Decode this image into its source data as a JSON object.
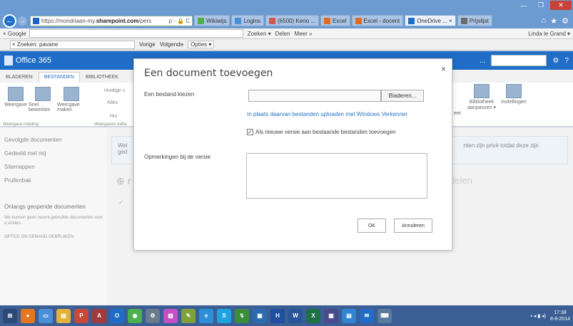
{
  "browser": {
    "address": {
      "prefix": "https://mondriaan-my.",
      "domain": "sharepoint.com",
      "suffix": "/pers",
      "icons": "ρ - 🔒 C"
    },
    "tabs": [
      {
        "label": "Wikiwijs",
        "color": "#4caf50"
      },
      {
        "label": "Logins",
        "color": "#4a90d9"
      },
      {
        "label": "(6500) Kerio ...",
        "color": "#d9534f"
      },
      {
        "label": "Excel",
        "color": "#e06b1f"
      },
      {
        "label": "Excel - docent",
        "color": "#e06b1f"
      },
      {
        "label": "OneDrive ... ×",
        "color": "#1f6dc6",
        "active": true
      },
      {
        "label": "Prijslijst",
        "color": "#6b6b6b"
      }
    ],
    "nav_right": [
      "⌂",
      "★",
      "⚙"
    ],
    "google": {
      "label": "× Google",
      "buttons": [
        "Zoeken ▾",
        "Delen",
        "Meer »"
      ],
      "user": "Linda le Grand ▾"
    },
    "find": {
      "label": "× Zoeken: pavane",
      "prev": "Vorige",
      "next": "Volgende",
      "options": "Opties ▾"
    },
    "window_controls": [
      "—",
      "❐",
      "✕"
    ]
  },
  "sharepoint": {
    "suite_title": "Office 365",
    "suite_right": "...",
    "suite_icons": [
      "⚙",
      "?"
    ],
    "ribbon_tabs": [
      "BLADEREN",
      "BESTANDEN",
      "BIBLIOTHEEK"
    ],
    "ribbon_groups": [
      {
        "label": "Weergave"
      },
      {
        "label": "Snel bewerken"
      },
      {
        "label": "Weergave maken"
      }
    ],
    "ribbon_small": [
      "Huidige v",
      "Alles",
      "Hui"
    ],
    "ribbon_group_labels": [
      "Weergave-indeling",
      "Weergaven behe"
    ],
    "ribbon_right": [
      {
        "label": "eet"
      },
      {
        "label": "Bibliotheek aanpassen ▾"
      },
      {
        "label": "Instellingen"
      }
    ],
    "sidebar": {
      "items": [
        "Gevolgde documenten",
        "Gedeeld met mij",
        "Sitemappen",
        "Prullenbak"
      ],
      "recent_title": "Onlangs geopende documenten",
      "recent_note": "We kunnen geen recent gebruikte documenten voor u vinden.",
      "office_on_demand": "OFFICE ON DEMAND GEBRUIKEN"
    },
    "info_left_1": "Wel",
    "info_left_2": "ged",
    "info_right": "nten zijn privé totdat deze zijn",
    "new_prefix": "⊕ r",
    "share_text": "delen",
    "check_mark": "✓"
  },
  "dialog": {
    "title": "Een document toevoegen",
    "close": "×",
    "choose_file_label": "Een bestand kiezen",
    "browse_button": "Bladeren...",
    "upload_link": "In plaats daarvan bestanden uploaden met Windows Verkenner",
    "new_version_checkbox": "Als nieuwe versie aan bestaande bestanden toevoegen",
    "new_version_checked": "✓",
    "comments_label": "Opmerkingen bij de versie",
    "ok_button": "OK",
    "cancel_button": "Annuleren"
  },
  "taskbar": {
    "icons": [
      {
        "name": "start",
        "label": "⊞",
        "color": "#2b4a78"
      },
      {
        "name": "firefox",
        "label": "●",
        "color": "#e6761f"
      },
      {
        "name": "monitor",
        "label": "▭",
        "color": "#4a90d9"
      },
      {
        "name": "folder",
        "label": "▤",
        "color": "#e3b23c"
      },
      {
        "name": "powerpoint",
        "label": "P",
        "color": "#c9483a"
      },
      {
        "name": "access",
        "label": "A",
        "color": "#a23b3b"
      },
      {
        "name": "outlook",
        "label": "O",
        "color": "#1f6dc6"
      },
      {
        "name": "chrome",
        "label": "◉",
        "color": "#4caf50"
      },
      {
        "name": "settings",
        "label": "⚙",
        "color": "#6b7b8c"
      },
      {
        "name": "paint",
        "label": "▨",
        "color": "#c44ec4"
      },
      {
        "name": "sketch",
        "label": "✎",
        "color": "#7fa33a"
      },
      {
        "name": "ie",
        "label": "e",
        "color": "#2c8fd8"
      },
      {
        "name": "skype",
        "label": "S",
        "color": "#1fa3e0"
      },
      {
        "name": "ftp",
        "label": "↯",
        "color": "#3a8d3a"
      },
      {
        "name": "media",
        "label": "▣",
        "color": "#2b6cb0"
      },
      {
        "name": "hema",
        "label": "H",
        "color": "#1f4f9e"
      },
      {
        "name": "word",
        "label": "W",
        "color": "#2a5699"
      },
      {
        "name": "excel",
        "label": "X",
        "color": "#1e7145"
      },
      {
        "name": "calc",
        "label": "▦",
        "color": "#4a4a8c"
      },
      {
        "name": "explorer",
        "label": "▤",
        "color": "#2f84d4"
      },
      {
        "name": "mail",
        "label": "✉",
        "color": "#1f6dc6"
      },
      {
        "name": "keyboard",
        "label": "⌨",
        "color": "#5a7aa0"
      }
    ],
    "tray_text": "▪ ◂ ▮ ◂)",
    "time": "17:38",
    "date": "8-8-2014"
  }
}
